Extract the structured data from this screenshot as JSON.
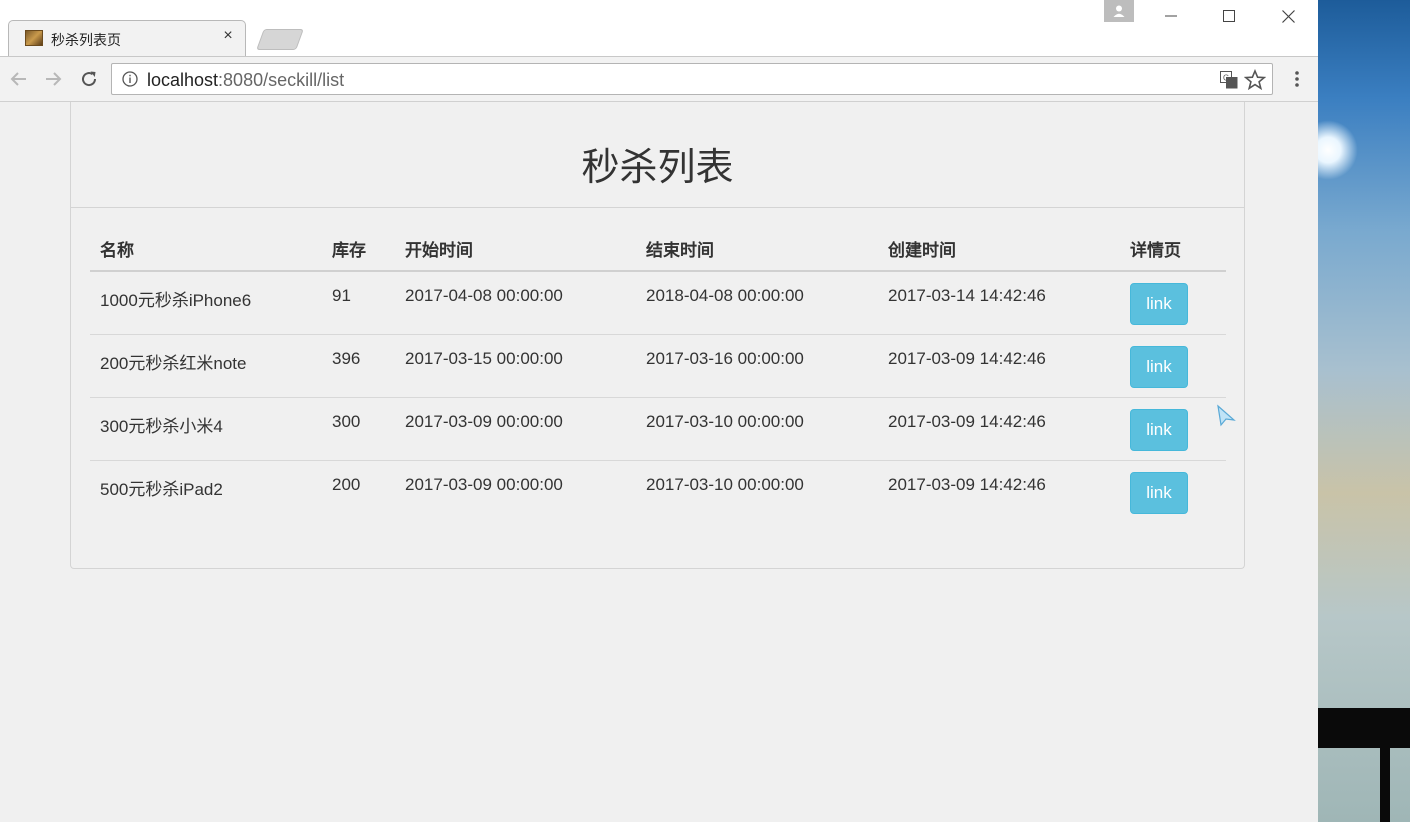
{
  "browser": {
    "tab_title": "秒杀列表页",
    "tab_close": "×",
    "url_host": "localhost",
    "url_rest": ":8080/seckill/list"
  },
  "page": {
    "heading": "秒杀列表",
    "columns": [
      "名称",
      "库存",
      "开始时间",
      "结束时间",
      "创建时间",
      "详情页"
    ],
    "rows": [
      {
        "name": "1000元秒杀iPhone6",
        "stock": "91",
        "start": "2017-04-08 00:00:00",
        "end": "2018-04-08 00:00:00",
        "created": "2017-03-14 14:42:46",
        "action": "link"
      },
      {
        "name": "200元秒杀红米note",
        "stock": "396",
        "start": "2017-03-15 00:00:00",
        "end": "2017-03-16 00:00:00",
        "created": "2017-03-09 14:42:46",
        "action": "link"
      },
      {
        "name": "300元秒杀小米4",
        "stock": "300",
        "start": "2017-03-09 00:00:00",
        "end": "2017-03-10 00:00:00",
        "created": "2017-03-09 14:42:46",
        "action": "link"
      },
      {
        "name": "500元秒杀iPad2",
        "stock": "200",
        "start": "2017-03-09 00:00:00",
        "end": "2017-03-10 00:00:00",
        "created": "2017-03-09 14:42:46",
        "action": "link"
      }
    ]
  },
  "colors": {
    "info_button": "#5bc0de",
    "text": "#333333",
    "page_bg": "#f0f0f0"
  }
}
